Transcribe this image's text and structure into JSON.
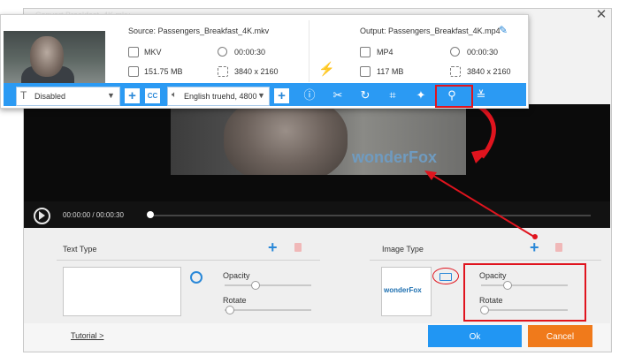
{
  "window": {
    "title": "Convert Breakfast_4K.mkv",
    "close_icon": "close-icon"
  },
  "source": {
    "label": "Source: Passengers_Breakfast_4K.mkv",
    "format": "MKV",
    "duration": "00:00:30",
    "size": "151.75 MB",
    "resolution": "3840 x 2160"
  },
  "output": {
    "label": "Output: Passengers_Breakfast_4K.mp4",
    "format": "MP4",
    "duration": "00:00:30",
    "size": "117 MB",
    "resolution": "3840 x 2160"
  },
  "toolbar": {
    "subtitle_value": "Disabled",
    "cc_label": "CC",
    "audio_value": "English truehd, 4800",
    "icons": [
      "info-icon",
      "scissors-icon",
      "rotate-icon",
      "crop-icon",
      "effects-icon",
      "watermark-icon",
      "subtitle-edit-icon"
    ]
  },
  "player": {
    "time": "00:00:00 / 00:00:30",
    "progress": 0,
    "watermark_text": "wonderFox"
  },
  "text_panel": {
    "title": "Text Type",
    "opacity_label": "Opacity",
    "rotate_label": "Rotate",
    "opacity_value": 0.35,
    "rotate_value": 0.05
  },
  "image_panel": {
    "title": "Image Type",
    "image_text": "wonderFox",
    "opacity_label": "Opacity",
    "rotate_label": "Rotate",
    "opacity_value": 0.3,
    "rotate_value": 0.03
  },
  "footer": {
    "tutorial_label": "Tutorial >",
    "ok_label": "Ok",
    "cancel_label": "Cancel"
  },
  "colors": {
    "accent_blue": "#2b9af3",
    "cancel_orange": "#f07a1b",
    "annotation_red": "#e0141e"
  }
}
